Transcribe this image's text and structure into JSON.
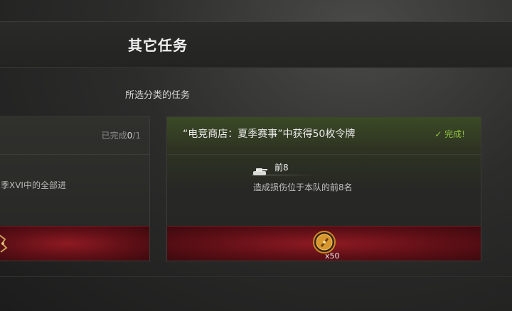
{
  "header": {
    "title": "其它任务"
  },
  "section": {
    "label": "所选分类的任务"
  },
  "left_card": {
    "status_prefix": "已完成",
    "status_done": "0",
    "status_total": "/1",
    "description": "季XVI中的全部进"
  },
  "right_card": {
    "title": "“电竞商店：夏季赛事”中获得50枚令牌",
    "status": "✓ 完成!",
    "condition_name": "前8",
    "condition_desc": "造成损伤位于本队的前8名",
    "reward_count": "x50"
  },
  "colors": {
    "accent_green": "#8ec23f",
    "reward_red": "#8e1a22",
    "token_gold": "#c98a2a"
  },
  "icons": {
    "condition": "tank-icon",
    "reward": "token-icon",
    "left_reward": "emblem-icon"
  }
}
